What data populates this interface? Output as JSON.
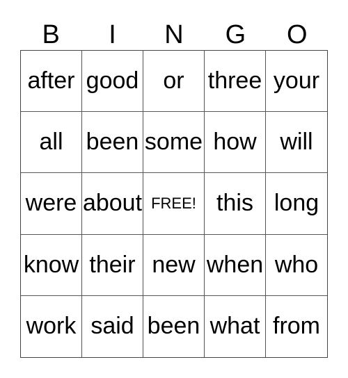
{
  "header": [
    "B",
    "I",
    "N",
    "G",
    "O"
  ],
  "cells": [
    [
      "after",
      "good",
      "or",
      "three",
      "your"
    ],
    [
      "all",
      "been",
      "some",
      "how",
      "will"
    ],
    [
      "were",
      "about",
      "FREE!",
      "this",
      "long"
    ],
    [
      "know",
      "their",
      "new",
      "when",
      "who"
    ],
    [
      "work",
      "said",
      "been",
      "what",
      "from"
    ]
  ]
}
